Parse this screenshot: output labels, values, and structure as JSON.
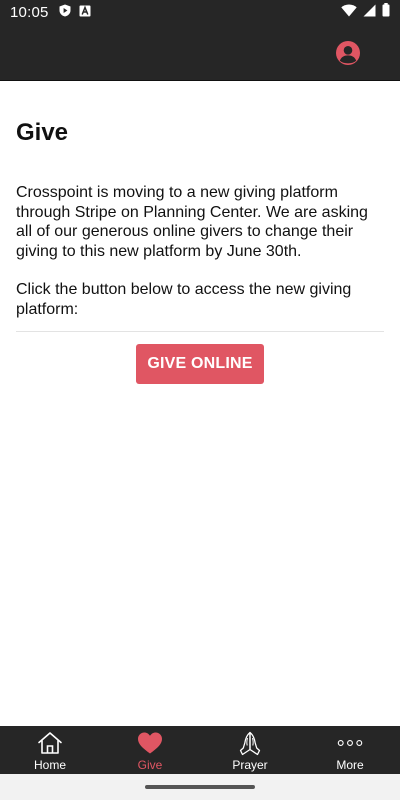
{
  "status": {
    "time": "10:05",
    "left_icons": [
      "shield-play-icon",
      "a-box-icon"
    ],
    "right_icons": [
      "wifi-icon",
      "signal-icon",
      "battery-icon"
    ]
  },
  "header": {
    "profile_icon": "user-circle-icon",
    "accent_color": "#e05663"
  },
  "main": {
    "title": "Give",
    "intro": "Crosspoint is moving to a new giving platform through Stripe on Planning Center. We are asking all of our generous online givers to change their giving to this new platform by June 30th.",
    "instruction": "Click the button below to access the new giving platform:",
    "give_button_label": "GIVE ONLINE"
  },
  "tabs": [
    {
      "label": "Home",
      "icon": "house-icon",
      "active": false
    },
    {
      "label": "Give",
      "icon": "heart-icon",
      "active": true
    },
    {
      "label": "Prayer",
      "icon": "praying-hands-icon",
      "active": false
    },
    {
      "label": "More",
      "icon": "more-dots-icon",
      "active": false
    }
  ]
}
